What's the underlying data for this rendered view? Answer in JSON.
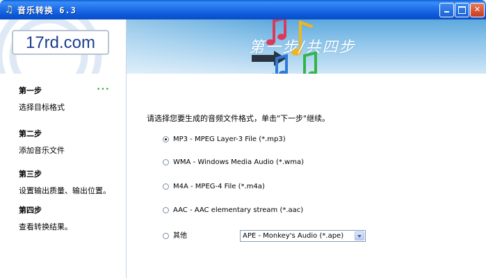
{
  "window": {
    "title": "音乐转换 6.3",
    "app_icon": "music-app-icon"
  },
  "logo": {
    "text": "17rd.com"
  },
  "banner": {
    "title": "第一步/共四步"
  },
  "steps": [
    {
      "title": "第一步",
      "desc": "选择目标格式",
      "active": true
    },
    {
      "title": "第二步",
      "desc": "添加音乐文件",
      "active": false
    },
    {
      "title": "第三步",
      "desc": "设置输出质量、输出位置。",
      "active": false
    },
    {
      "title": "第四步",
      "desc": "查看转换结果。",
      "active": false
    }
  ],
  "active_indicator": "•••",
  "main": {
    "instruction": "请选择您要生成的音频文件格式，单击\"下一步\"继续。",
    "options": [
      {
        "label": "MP3 - MPEG Layer-3 File (*.mp3)",
        "checked": true
      },
      {
        "label": "WMA - Windows Media Audio (*.wma)",
        "checked": false
      },
      {
        "label": "M4A - MPEG-4 File (*.m4a)",
        "checked": false
      },
      {
        "label": "AAC - AAC elementary stream (*.aac)",
        "checked": false
      },
      {
        "label": "其他",
        "checked": false
      }
    ],
    "other_format_select": {
      "value": "APE - Monkey's Audio (*.ape)"
    }
  },
  "colors": {
    "titlebar": "#1f6fea",
    "banner": "#8cc4ea",
    "step_dots": "#2da82d",
    "logo_text": "#1b3e8c"
  }
}
